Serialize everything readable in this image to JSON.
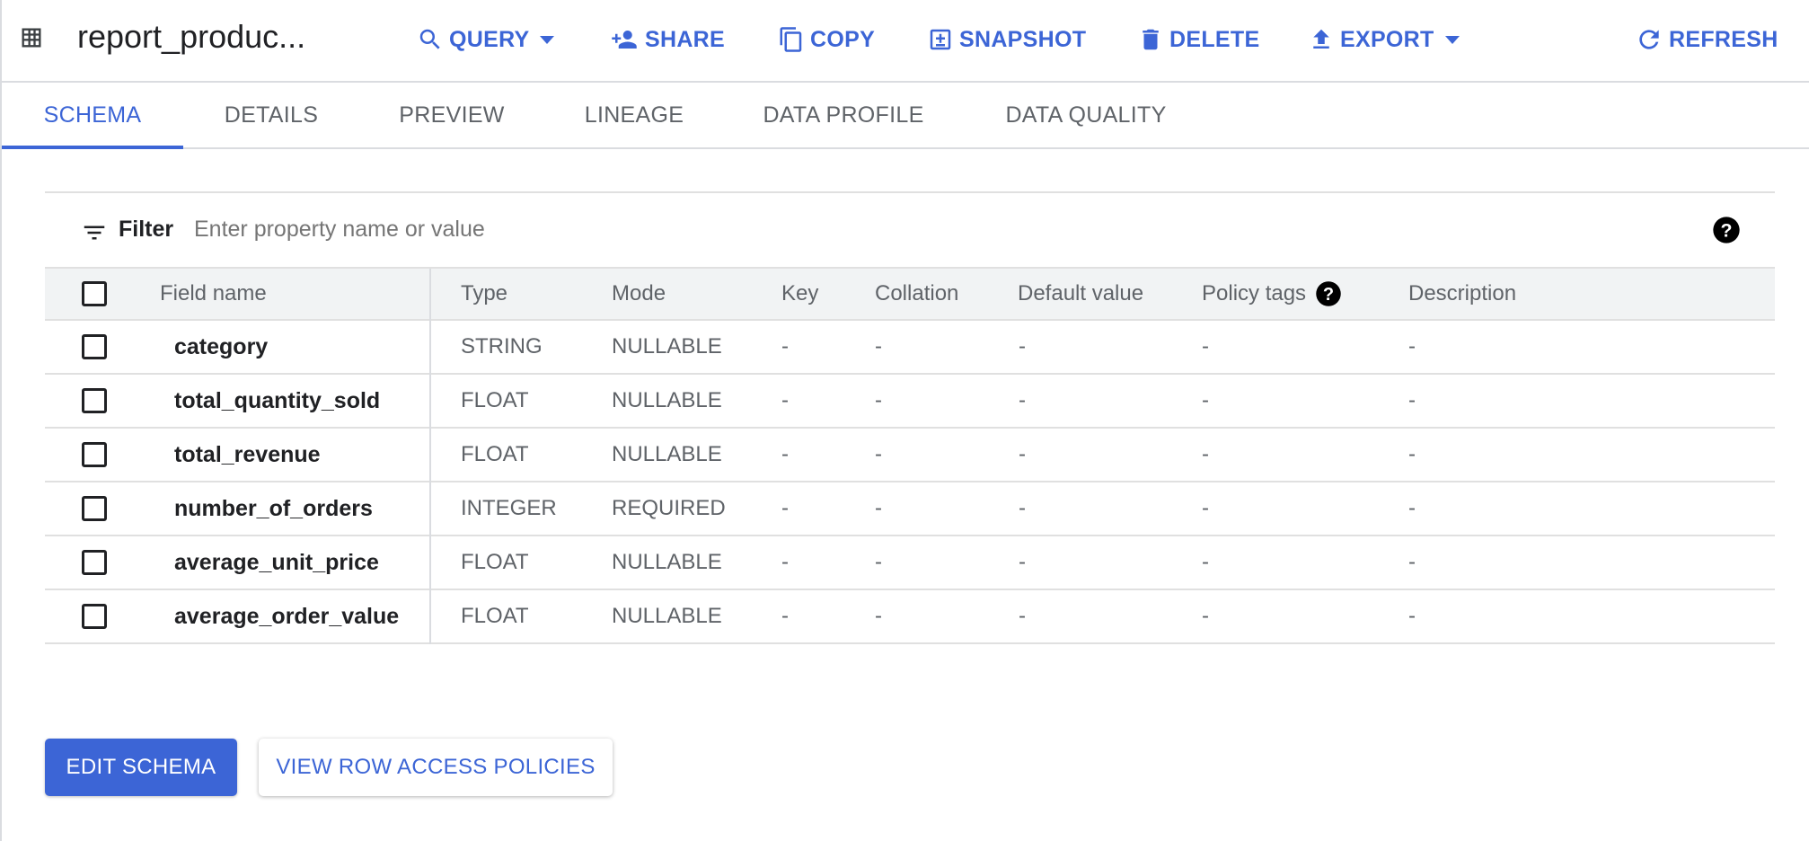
{
  "header": {
    "title": "report_produc...",
    "actions": {
      "query": "QUERY",
      "share": "SHARE",
      "copy": "COPY",
      "snapshot": "SNAPSHOT",
      "delete": "DELETE",
      "export": "EXPORT",
      "refresh": "REFRESH"
    }
  },
  "tabs": [
    "SCHEMA",
    "DETAILS",
    "PREVIEW",
    "LINEAGE",
    "DATA PROFILE",
    "DATA QUALITY"
  ],
  "active_tab": "SCHEMA",
  "filter": {
    "label": "Filter",
    "placeholder": "Enter property name or value"
  },
  "table": {
    "columns": [
      "Field name",
      "Type",
      "Mode",
      "Key",
      "Collation",
      "Default value",
      "Policy tags",
      "Description"
    ],
    "rows": [
      {
        "name": "category",
        "type": "STRING",
        "mode": "NULLABLE",
        "key": "-",
        "collation": "-",
        "default": "-",
        "policy": "-",
        "description": "-"
      },
      {
        "name": "total_quantity_sold",
        "type": "FLOAT",
        "mode": "NULLABLE",
        "key": "-",
        "collation": "-",
        "default": "-",
        "policy": "-",
        "description": "-"
      },
      {
        "name": "total_revenue",
        "type": "FLOAT",
        "mode": "NULLABLE",
        "key": "-",
        "collation": "-",
        "default": "-",
        "policy": "-",
        "description": "-"
      },
      {
        "name": "number_of_orders",
        "type": "INTEGER",
        "mode": "REQUIRED",
        "key": "-",
        "collation": "-",
        "default": "-",
        "policy": "-",
        "description": "-"
      },
      {
        "name": "average_unit_price",
        "type": "FLOAT",
        "mode": "NULLABLE",
        "key": "-",
        "collation": "-",
        "default": "-",
        "policy": "-",
        "description": "-"
      },
      {
        "name": "average_order_value",
        "type": "FLOAT",
        "mode": "NULLABLE",
        "key": "-",
        "collation": "-",
        "default": "-",
        "policy": "-",
        "description": "-"
      }
    ]
  },
  "buttons": {
    "edit_schema": "EDIT SCHEMA",
    "view_row_access": "VIEW ROW ACCESS POLICIES"
  },
  "colors": {
    "accent": "#3c65d6",
    "header_row_bg": "#f1f3f4",
    "divider": "#e0e0e0"
  },
  "icons": [
    "table-icon",
    "search-icon",
    "person-add-icon",
    "copy-icon",
    "snapshot-icon",
    "trash-icon",
    "upload-icon",
    "refresh-icon",
    "filter-icon",
    "help-icon"
  ]
}
